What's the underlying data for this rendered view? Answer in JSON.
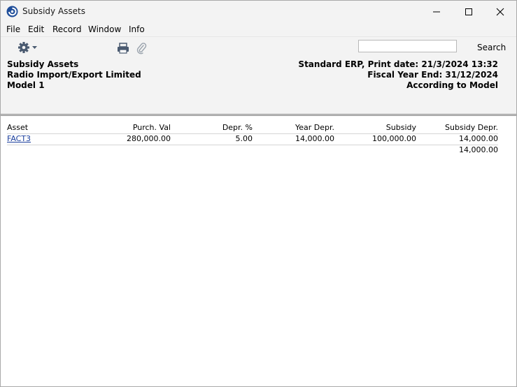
{
  "window": {
    "title": "Subsidy Assets"
  },
  "menu": [
    "File",
    "Edit",
    "Record",
    "Window",
    "Info"
  ],
  "toolbar": {
    "search_label": "Search",
    "search_value": ""
  },
  "report_header": {
    "left": [
      "Subsidy Assets",
      "Radio Import/Export Limited",
      "Model 1"
    ],
    "right": [
      "Standard ERP, Print date: 21/3/2024 13:32",
      "Fiscal Year End: 31/12/2024",
      "According to Model"
    ]
  },
  "table": {
    "columns": [
      "Asset",
      "Purch. Val",
      "Depr. %",
      "Year Depr.",
      "Subsidy",
      "Subsidy Depr."
    ],
    "rows": [
      [
        "FACT3",
        "280,000.00",
        "5.00",
        "14,000.00",
        "100,000.00",
        "14,000.00"
      ]
    ],
    "total": "14,000.00"
  }
}
